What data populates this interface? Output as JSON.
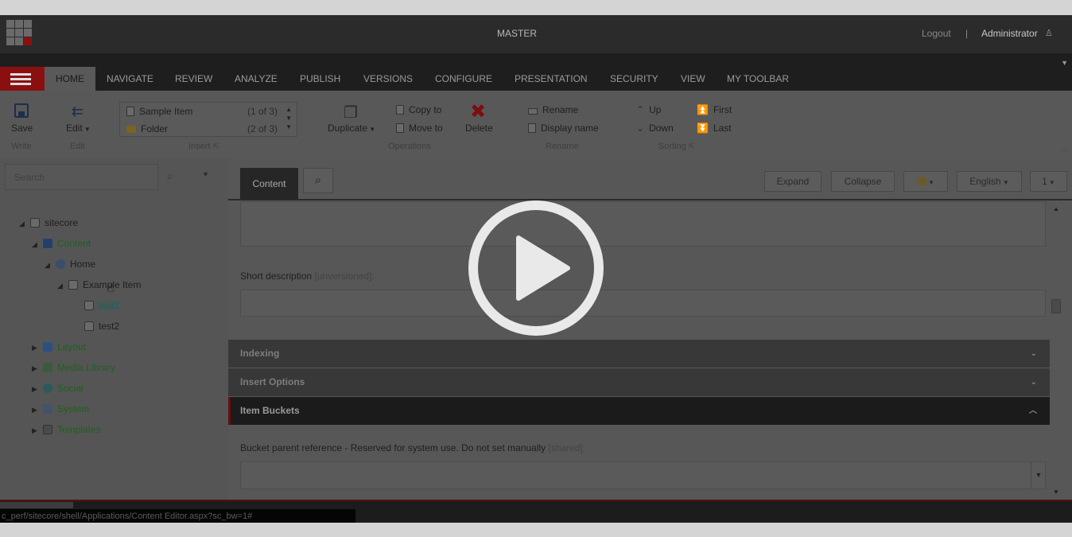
{
  "header": {
    "database": "MASTER",
    "logout": "Logout",
    "separator": "|",
    "user": "Administrator",
    "user_icon": "person-icon"
  },
  "tabs": [
    {
      "label": "HOME",
      "active": true
    },
    {
      "label": "NAVIGATE"
    },
    {
      "label": "REVIEW"
    },
    {
      "label": "ANALYZE"
    },
    {
      "label": "PUBLISH"
    },
    {
      "label": "VERSIONS"
    },
    {
      "label": "CONFIGURE"
    },
    {
      "label": "PRESENTATION"
    },
    {
      "label": "SECURITY"
    },
    {
      "label": "VIEW"
    },
    {
      "label": "MY TOOLBAR"
    }
  ],
  "ribbon": {
    "save": "Save",
    "edit": "Edit",
    "insert_items": [
      {
        "label": "Sample Item",
        "count": "(1 of 3)"
      },
      {
        "label": "Folder",
        "count": "(2 of 3)"
      }
    ],
    "duplicate": "Duplicate",
    "copy_to": "Copy to",
    "move_to": "Move to",
    "delete": "Delete",
    "rename": "Rename",
    "display_name": "Display name",
    "up": "Up",
    "down": "Down",
    "first": "First",
    "last": "Last",
    "groups": {
      "write": "Write",
      "edit": "Edit",
      "insert": "Insert",
      "operations": "Operations",
      "rename": "Rename",
      "sorting": "Sorting"
    }
  },
  "tree": {
    "search_placeholder": "Search",
    "nodes": [
      {
        "label": "sitecore",
        "color": "#1e1e1e"
      },
      {
        "label": "Content",
        "color": "#1f5f1f"
      },
      {
        "label": "Home",
        "color": "#1e1e1e"
      },
      {
        "label": "Example Item",
        "color": "#1e1e1e"
      },
      {
        "label": "test1",
        "color": "#1f5f5f"
      },
      {
        "label": "test2",
        "color": "#1e1e1e"
      },
      {
        "label": "Layout",
        "color": "#1f5f1f"
      },
      {
        "label": "Media Library",
        "color": "#1f5f1f"
      },
      {
        "label": "Social",
        "color": "#1f5f1f"
      },
      {
        "label": "System",
        "color": "#1f5f1f"
      },
      {
        "label": "Templates",
        "color": "#1f5f1f"
      }
    ]
  },
  "editor": {
    "content_tab": "Content",
    "expand": "Expand",
    "collapse": "Collapse",
    "language": "English",
    "version": "1",
    "short_description_label": "Short description",
    "short_description_tag": "[unversioned]:",
    "sections": {
      "indexing": "Indexing",
      "insert_options": "Insert Options",
      "item_buckets": "Item Buckets"
    },
    "bucket_label": "Bucket parent reference - Reserved for system use. Do not set manually",
    "bucket_tag": "[shared]:"
  },
  "status_url": "c_perf/sitecore/shell/Applications/Content Editor.aspx?sc_bw=1#",
  "colors": {
    "accent_red": "#8a1010",
    "header_bg": "#2b2b2b",
    "ribbon_bg": "#585858"
  }
}
